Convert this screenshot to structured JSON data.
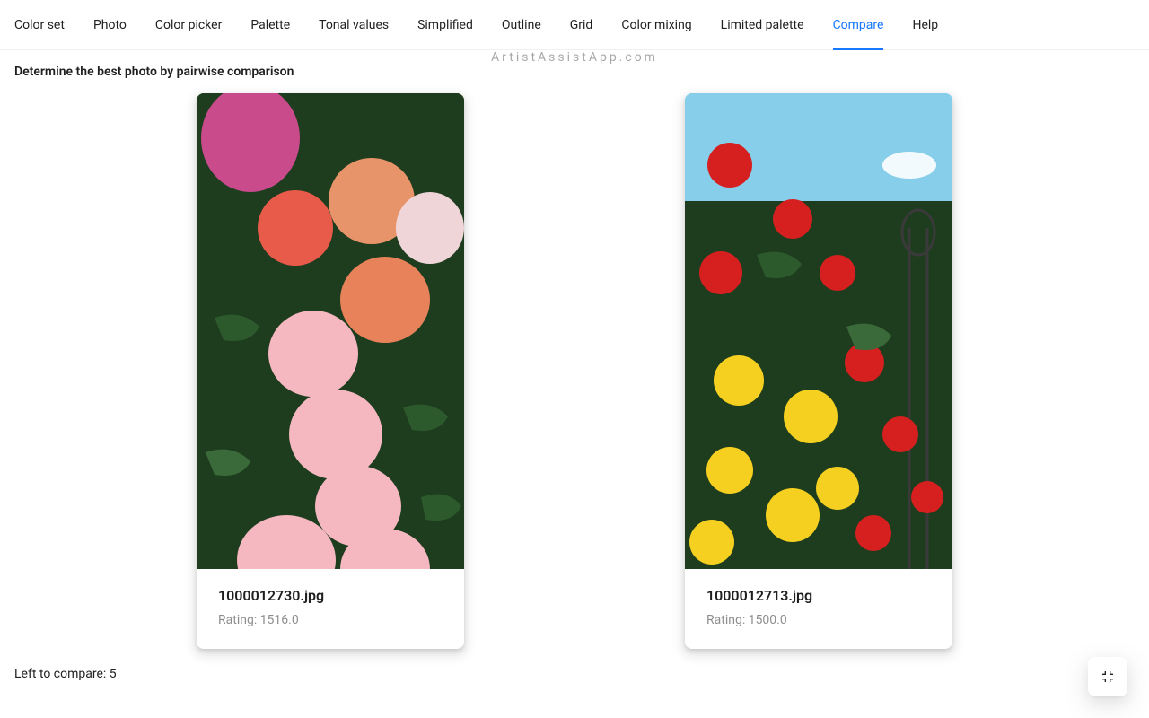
{
  "brand": "ArtistAssistApp.com",
  "tabs": [
    {
      "label": "Color set",
      "active": false
    },
    {
      "label": "Photo",
      "active": false
    },
    {
      "label": "Color picker",
      "active": false
    },
    {
      "label": "Palette",
      "active": false
    },
    {
      "label": "Tonal values",
      "active": false
    },
    {
      "label": "Simplified",
      "active": false
    },
    {
      "label": "Outline",
      "active": false
    },
    {
      "label": "Grid",
      "active": false
    },
    {
      "label": "Color mixing",
      "active": false
    },
    {
      "label": "Limited palette",
      "active": false
    },
    {
      "label": "Compare",
      "active": true
    },
    {
      "label": "Help",
      "active": false
    }
  ],
  "heading": "Determine the best photo by pairwise comparison",
  "cards": [
    {
      "filename": "1000012730.jpg",
      "rating_label": "Rating: 1516.0"
    },
    {
      "filename": "1000012713.jpg",
      "rating_label": "Rating: 1500.0"
    }
  ],
  "left_to_compare": "Left to compare: 5"
}
